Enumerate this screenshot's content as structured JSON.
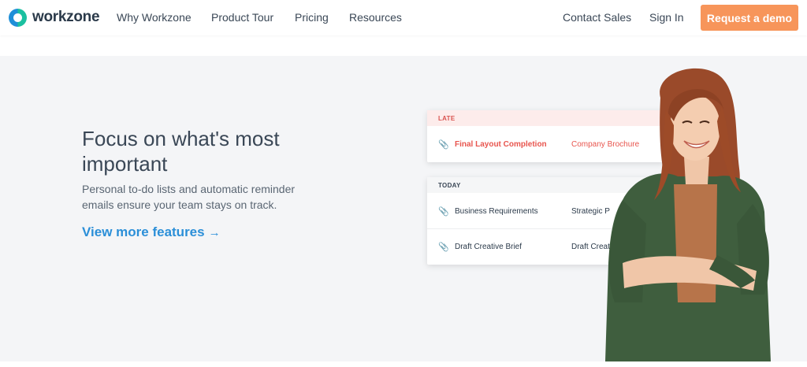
{
  "brand": {
    "name": "workzone"
  },
  "nav": {
    "links": [
      "Why Workzone",
      "Product Tour",
      "Pricing",
      "Resources"
    ],
    "contact": "Contact Sales",
    "signin": "Sign In",
    "cta": "Request a demo"
  },
  "hero": {
    "headline": "Focus on what's most important",
    "subtext": "Personal to-do lists and automatic reminder emails ensure your team stays on track.",
    "link": "View more features",
    "link_arrow": "→"
  },
  "late_card": {
    "header": "LATE",
    "rows": [
      {
        "task": "Final Layout Completion",
        "project": "Company Brochure"
      }
    ]
  },
  "today_card": {
    "header": "TODAY",
    "rows": [
      {
        "task": "Business Requirements",
        "project": "Strategic P"
      },
      {
        "task": "Draft Creative Brief",
        "project": "Draft Creativ"
      }
    ]
  },
  "colors": {
    "accent_orange": "#f7955a",
    "link_blue": "#2b8fd8",
    "late_red": "#e8554e",
    "hero_bg": "#f4f5f7"
  },
  "icons": [
    "logo-ring-icon",
    "arrow-right-icon",
    "paperclip-icon"
  ]
}
